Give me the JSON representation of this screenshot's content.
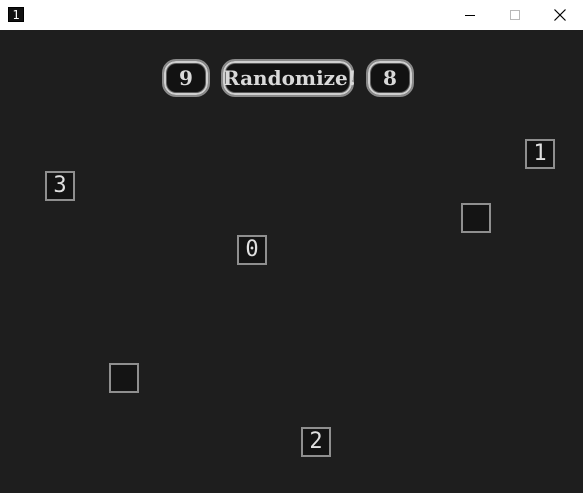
{
  "titlebar": {
    "app_icon_glyph": "1",
    "minimize_icon": "minimize-icon",
    "maximize_icon": "maximize-icon",
    "close_icon": "close-icon"
  },
  "controls": {
    "left_counter": "9",
    "randomize_label": "Randomize!",
    "right_counter": "8"
  },
  "tiles": [
    {
      "label": "1"
    },
    {
      "label": "3"
    },
    {
      "label": ""
    },
    {
      "label": "0"
    },
    {
      "label": ""
    },
    {
      "label": "2"
    }
  ],
  "colors": {
    "background": "#1e1e1e",
    "tile_border": "#8f8f8f",
    "text": "#e0e0e0"
  }
}
